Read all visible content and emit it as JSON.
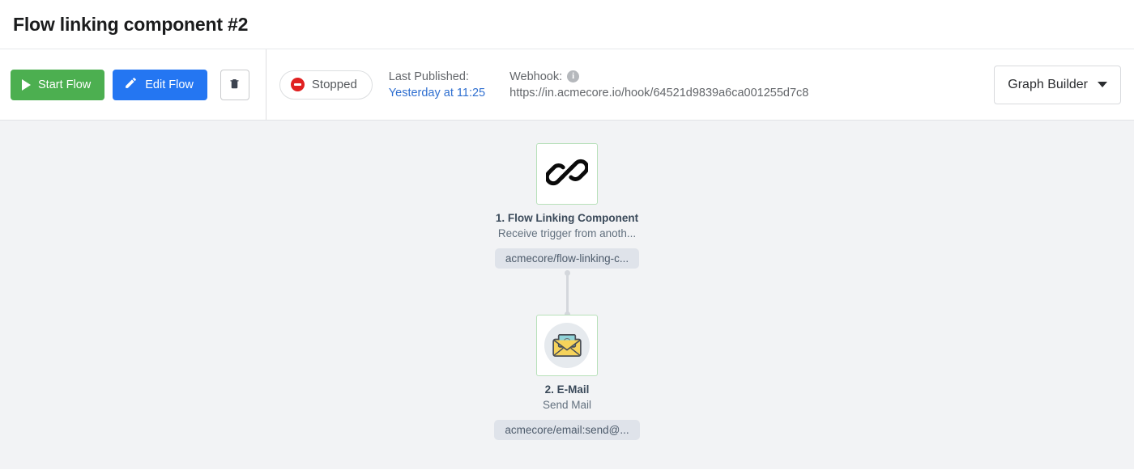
{
  "header": {
    "title": "Flow linking component #2"
  },
  "toolbar": {
    "start_label": "Start Flow",
    "edit_label": "Edit Flow",
    "delete_icon": "trash-icon",
    "play_icon": "play-icon",
    "pencil_icon": "pencil-icon",
    "status": {
      "label": "Stopped",
      "icon": "no-entry-icon",
      "color": "#e02020"
    },
    "last_published": {
      "label": "Last Published:",
      "value": "Yesterday at 11:25",
      "link_color": "#2f6fd0"
    },
    "webhook": {
      "label": "Webhook:",
      "info_icon": "info-icon",
      "url": "https://in.acmecore.io/hook/64521d9839a6ca001255d7c8"
    },
    "view_select": {
      "value": "Graph Builder",
      "caret_icon": "chevron-down-icon"
    }
  },
  "canvas": {
    "background": "#f2f3f5",
    "nodes": [
      {
        "icon": "link-chain-icon",
        "title": "1. Flow Linking Component",
        "subtitle": "Receive trigger from anoth...",
        "chip": "acmecore/flow-linking-c...",
        "border_color": "#b7e0b9"
      },
      {
        "icon": "email-envelope-icon",
        "title": "2. E-Mail",
        "subtitle": "Send Mail",
        "chip": "acmecore/email:send@...",
        "border_color": "#b7e0b9"
      }
    ],
    "connector": {
      "color": "#d4d7dc"
    }
  }
}
